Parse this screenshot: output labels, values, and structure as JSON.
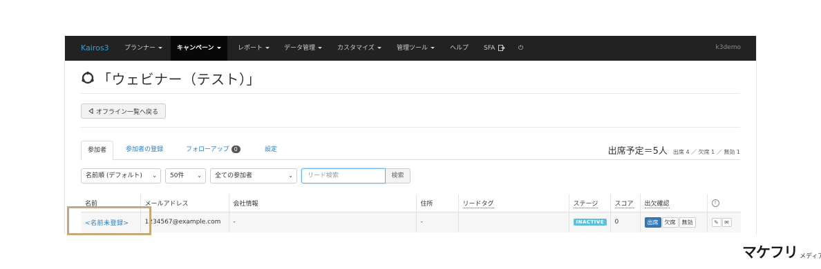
{
  "navbar": {
    "brand": "Kairos3",
    "items": [
      {
        "label": "プランナー",
        "caret": true
      },
      {
        "label": "キャンペーン",
        "caret": true,
        "active": true
      },
      {
        "label": "レポート",
        "caret": true
      },
      {
        "label": "データ管理",
        "caret": true
      },
      {
        "label": "カスタマイズ",
        "caret": true
      },
      {
        "label": "管理ツール",
        "caret": true
      },
      {
        "label": "ヘルプ",
        "caret": false
      },
      {
        "label": "SFA",
        "caret": false
      },
      {
        "label": "⏻",
        "caret": false
      }
    ],
    "user": "k3demo"
  },
  "page": {
    "title": "「ウェビナー（テスト）」",
    "back_label": "オフライン一覧へ戻る"
  },
  "tabs": [
    {
      "label": "参加者",
      "active": true
    },
    {
      "label": "参加者の登録"
    },
    {
      "label": "フォローアップ",
      "badge": "0"
    },
    {
      "label": "設定"
    }
  ],
  "summary": {
    "main": "出席予定＝5人",
    "sub": "出席 4 ／ 欠席 1 ／ 無効 1"
  },
  "filters": {
    "sort": "名前順 (デフォルト)",
    "per_page": "50件",
    "audience": "全ての参加者",
    "search_placeholder": "リード検索",
    "search_button": "検索"
  },
  "table": {
    "headers": [
      "名前",
      "メールアドレス",
      "会社情報",
      "住所",
      "リードタグ",
      "ステージ",
      "スコア",
      "出欠確認",
      "ⓘ"
    ],
    "rows": [
      {
        "name": "<名前未登録>",
        "email": "1234567@example.com",
        "company": "-",
        "address": "-",
        "tag": "",
        "stage": "INACTIVE",
        "score": "0",
        "attendance": [
          "出席",
          "欠席",
          "無効"
        ]
      }
    ]
  },
  "colors": {
    "navbar_bg": "#222222",
    "brand": "#2ea3dc",
    "link": "#2a7dc0",
    "stage_badge": "#5bc0de",
    "primary": "#337ab7",
    "highlight": "#c8a877"
  },
  "watermark": {
    "main": "マケフリ",
    "sub": "メディア"
  }
}
